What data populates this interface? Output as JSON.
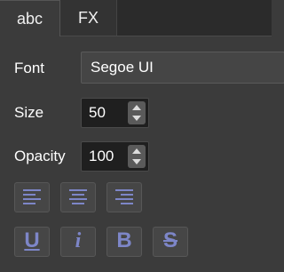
{
  "tabs": [
    {
      "label": "abc",
      "active": true
    },
    {
      "label": "FX",
      "active": false
    }
  ],
  "font": {
    "label": "Font",
    "value": "Segoe UI"
  },
  "size": {
    "label": "Size",
    "value": "50"
  },
  "opacity": {
    "label": "Opacity",
    "value": "100"
  },
  "align_buttons": [
    {
      "icon": "align-left-icon"
    },
    {
      "icon": "align-center-icon"
    },
    {
      "icon": "align-right-icon"
    }
  ],
  "style_buttons": [
    {
      "icon": "underline-icon",
      "glyph": "U"
    },
    {
      "icon": "italic-icon",
      "glyph": "i"
    },
    {
      "icon": "bold-icon",
      "glyph": "B"
    },
    {
      "icon": "strikethrough-icon",
      "glyph": "S"
    }
  ],
  "colors": {
    "icon_blue": "#7d86c8",
    "panel": "#3b3b3b"
  }
}
